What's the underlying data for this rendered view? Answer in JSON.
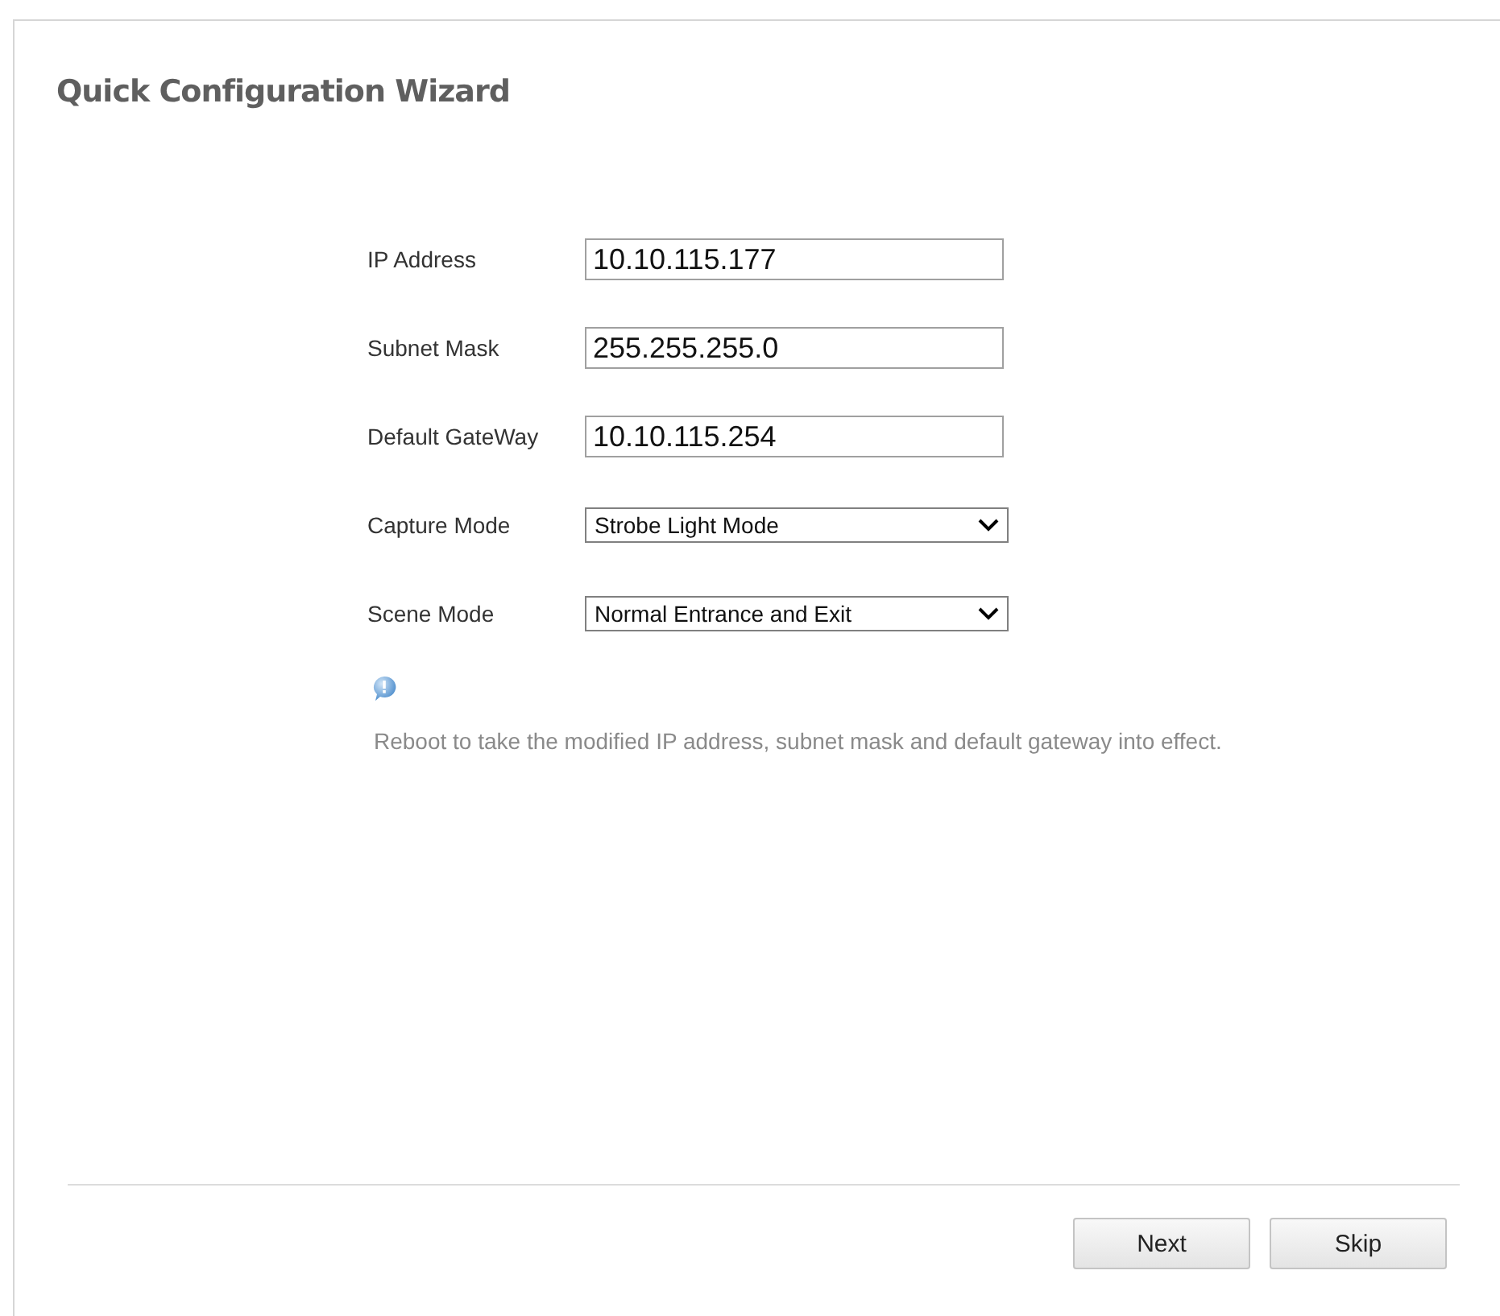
{
  "title": "Quick Configuration Wizard",
  "fields": [
    {
      "kind": "text",
      "label": "IP Address",
      "value": "10.10.115.177"
    },
    {
      "kind": "text",
      "label": "Subnet Mask",
      "value": "255.255.255.0"
    },
    {
      "kind": "text",
      "label": "Default GateWay",
      "value": "10.10.115.254"
    },
    {
      "kind": "select",
      "label": "Capture Mode",
      "value": "Strobe Light Mode"
    },
    {
      "kind": "select",
      "label": "Scene Mode",
      "value": "Normal Entrance and Exit"
    }
  ],
  "note": "Reboot to take the modified IP address, subnet mask and default gateway into effect.",
  "buttons": [
    "Next",
    "Skip"
  ]
}
